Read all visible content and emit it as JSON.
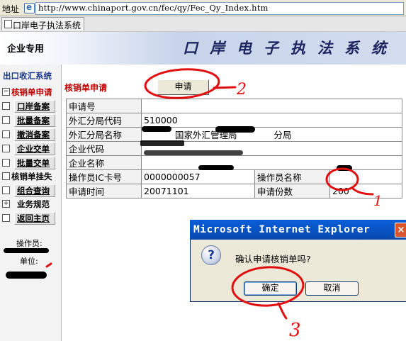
{
  "browser": {
    "address_label": "地址",
    "url": "http://www.chinaport.gov.cn/fec/qy/Fec_Qy_Index.htm",
    "tab_label": "口岸电子执法系统"
  },
  "banner": {
    "enterprise_label": "企业专用",
    "system_title": "口岸电子执法系统"
  },
  "sidebar": {
    "title": "出口收汇系统",
    "items": [
      {
        "box": "−",
        "label": "核销单申请"
      },
      {
        "box": "",
        "label": "口岸备案"
      },
      {
        "box": "",
        "label": "批量备案"
      },
      {
        "box": "",
        "label": "撤消备案"
      },
      {
        "box": "",
        "label": "企业交单"
      },
      {
        "box": "",
        "label": "批量交单"
      },
      {
        "box": "",
        "label": "核销单挂失"
      },
      {
        "box": "",
        "label": "组合查询"
      },
      {
        "box": "+",
        "label": "业务规范"
      },
      {
        "box": "",
        "label": "返回主页"
      }
    ],
    "operator_label": "操作员:",
    "unit_label": "单位:"
  },
  "main": {
    "section_title": "核销单申请",
    "apply_button": "申请",
    "form": {
      "row1": {
        "label": "申请号",
        "value": ""
      },
      "row2": {
        "label": "外汇分局代码",
        "value": "510000"
      },
      "row3": {
        "label": "外汇分局名称",
        "value_mid": "国家外汇管理局",
        "value_end": "分局"
      },
      "row4": {
        "label": "企业代码",
        "value": ""
      },
      "row5": {
        "label": "企业名称",
        "value": ""
      },
      "row6": {
        "label": "操作员IC卡号",
        "value": "0000000057",
        "label2": "操作员名称",
        "value2": ""
      },
      "row7": {
        "label": "申请时间",
        "value": "20071101",
        "label2": "申请份数",
        "value2": "200"
      }
    }
  },
  "dialog": {
    "title": "Microsoft Internet Explorer",
    "close_glyph": "×",
    "icon_glyph": "?",
    "message": "确认申请核销单吗?",
    "ok_label": "确定",
    "cancel_label": "取消"
  },
  "annotations": {
    "n1": "1",
    "n2": "2",
    "n3": "3"
  },
  "colors": {
    "annotation_red": "#e01010",
    "active_red": "#c00000",
    "dialog_blue": "#0a5fd8"
  }
}
